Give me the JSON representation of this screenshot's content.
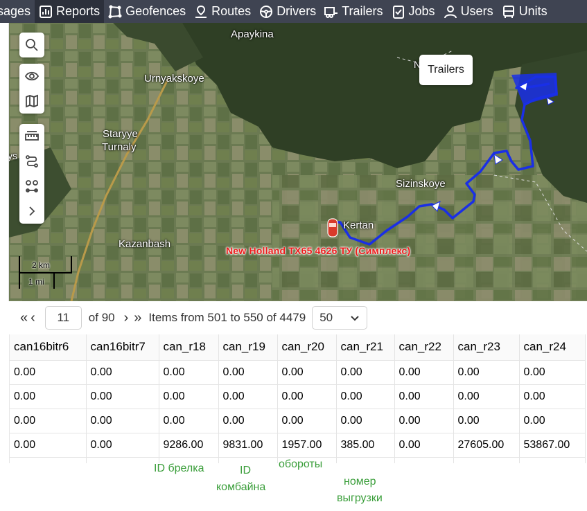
{
  "nav": {
    "items": [
      {
        "label": "sages",
        "icon": "none",
        "active": false
      },
      {
        "label": "Reports",
        "icon": "reports-icon",
        "active": true
      },
      {
        "label": "Geofences",
        "icon": "geofence-icon",
        "active": false
      },
      {
        "label": "Routes",
        "icon": "routes-icon",
        "active": false
      },
      {
        "label": "Drivers",
        "icon": "steering-wheel-icon",
        "active": false
      },
      {
        "label": "Trailers",
        "icon": "trailer-icon",
        "active": false
      },
      {
        "label": "Jobs",
        "icon": "checklist-icon",
        "active": false
      },
      {
        "label": "Users",
        "icon": "user-icon",
        "active": false
      },
      {
        "label": "Units",
        "icon": "bus-icon",
        "active": false
      }
    ]
  },
  "map": {
    "places": {
      "apaykina": "Apaykina",
      "urnyakskoye": "Urnyakskoye",
      "staryye": "Staryye",
      "turnaly": "Turnaly",
      "sizinskoye": "Sizinskoye",
      "kazanbash": "Kazanbash",
      "kertan": "Kertan",
      "ys": "ys",
      "n": "N"
    },
    "tooltip": "Trailers",
    "unit_label": "New Holland TX65 4626 ТУ (Симплекс)",
    "scale": {
      "metric": "2 km",
      "imperial": "1 mi"
    },
    "track_color": "#1a2fe6"
  },
  "pager": {
    "page": "11",
    "of": "of 90",
    "items": "Items from 501 to 550 of 4479",
    "per_page": "50"
  },
  "table": {
    "columns": [
      "can16bitr6",
      "can16bitr7",
      "can_r18",
      "can_r19",
      "can_r20",
      "can_r21",
      "can_r22",
      "can_r23",
      "can_r24"
    ],
    "rows": [
      [
        "0.00",
        "0.00",
        "0.00",
        "0.00",
        "0.00",
        "0.00",
        "0.00",
        "0.00",
        "0.00"
      ],
      [
        "0.00",
        "0.00",
        "0.00",
        "0.00",
        "0.00",
        "0.00",
        "0.00",
        "0.00",
        "0.00"
      ],
      [
        "0.00",
        "0.00",
        "0.00",
        "0.00",
        "0.00",
        "0.00",
        "0.00",
        "0.00",
        "0.00"
      ],
      [
        "0.00",
        "0.00",
        "9286.00",
        "9831.00",
        "1957.00",
        "385.00",
        "0.00",
        "27605.00",
        "53867.00"
      ]
    ]
  },
  "annotations": {
    "fob_id": "ID брелка",
    "combine_id_1": "ID",
    "combine_id_2": "комбайна",
    "rpm": "обороты",
    "unload_1": "номер",
    "unload_2": "выгрузки"
  }
}
